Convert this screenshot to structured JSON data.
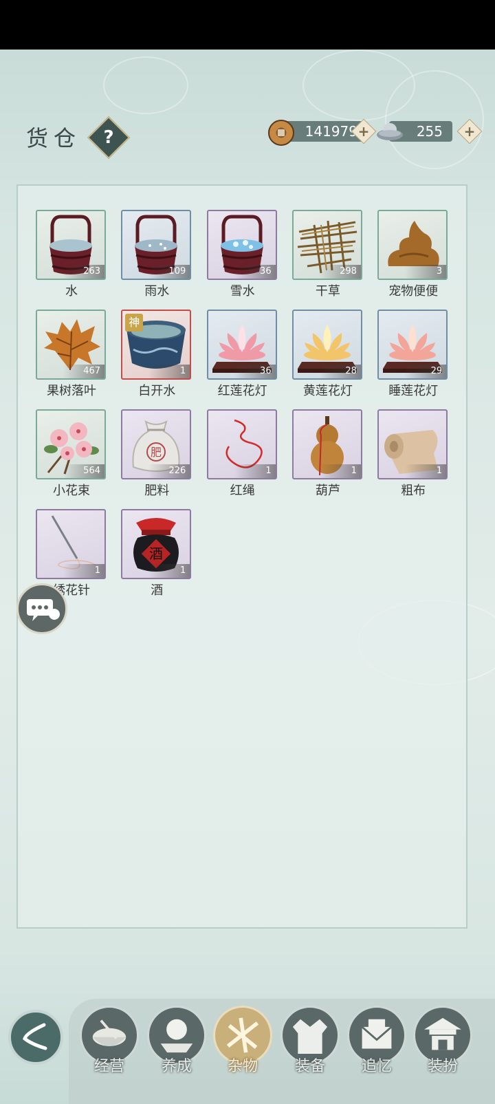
{
  "header": {
    "title": "货仓",
    "help": "?",
    "copper": "141979",
    "silver": "255",
    "add": "+"
  },
  "items": [
    {
      "name": "水",
      "count": "263",
      "art": "bucket-water",
      "frame": "green"
    },
    {
      "name": "雨水",
      "count": "109",
      "art": "bucket-rain",
      "frame": "blue"
    },
    {
      "name": "雪水",
      "count": "36",
      "art": "bucket-snow",
      "frame": "purple"
    },
    {
      "name": "干草",
      "count": "298",
      "art": "hay",
      "frame": "green"
    },
    {
      "name": "宠物便便",
      "count": "3",
      "art": "poop",
      "frame": "green"
    },
    {
      "name": "果树落叶",
      "count": "467",
      "art": "leaf",
      "frame": "green"
    },
    {
      "name": "白开水",
      "count": "1",
      "art": "bowl",
      "frame": "red",
      "badge": "神"
    },
    {
      "name": "红莲花灯",
      "count": "36",
      "art": "lotus-red",
      "frame": "blue"
    },
    {
      "name": "黄莲花灯",
      "count": "28",
      "art": "lotus-yellow",
      "frame": "blue"
    },
    {
      "name": "睡莲花灯",
      "count": "29",
      "art": "lotus-pink",
      "frame": "blue"
    },
    {
      "name": "小花束",
      "count": "564",
      "art": "flowers",
      "frame": "green"
    },
    {
      "name": "肥料",
      "count": "226",
      "art": "fertilizer",
      "frame": "purple"
    },
    {
      "name": "红绳",
      "count": "1",
      "art": "red-rope",
      "frame": "purple"
    },
    {
      "name": "葫芦",
      "count": "1",
      "art": "gourd",
      "frame": "purple"
    },
    {
      "name": "粗布",
      "count": "1",
      "art": "cloth",
      "frame": "purple"
    },
    {
      "name": "绣花针",
      "count": "1",
      "art": "needle",
      "frame": "purple"
    },
    {
      "name": "酒",
      "count": "1",
      "art": "wine-jar",
      "frame": "purple"
    }
  ],
  "art_labels": {
    "fertilizer": "肥",
    "wine": "酒"
  },
  "nav": [
    {
      "label": "经营",
      "icon": "bowl-icon",
      "active": false
    },
    {
      "label": "养成",
      "icon": "crystal-icon",
      "active": false
    },
    {
      "label": "杂物",
      "icon": "sticks-icon",
      "active": true
    },
    {
      "label": "装备",
      "icon": "robe-icon",
      "active": false
    },
    {
      "label": "追忆",
      "icon": "letter-icon",
      "active": false
    },
    {
      "label": "装扮",
      "icon": "pavilion-icon",
      "active": false
    }
  ]
}
